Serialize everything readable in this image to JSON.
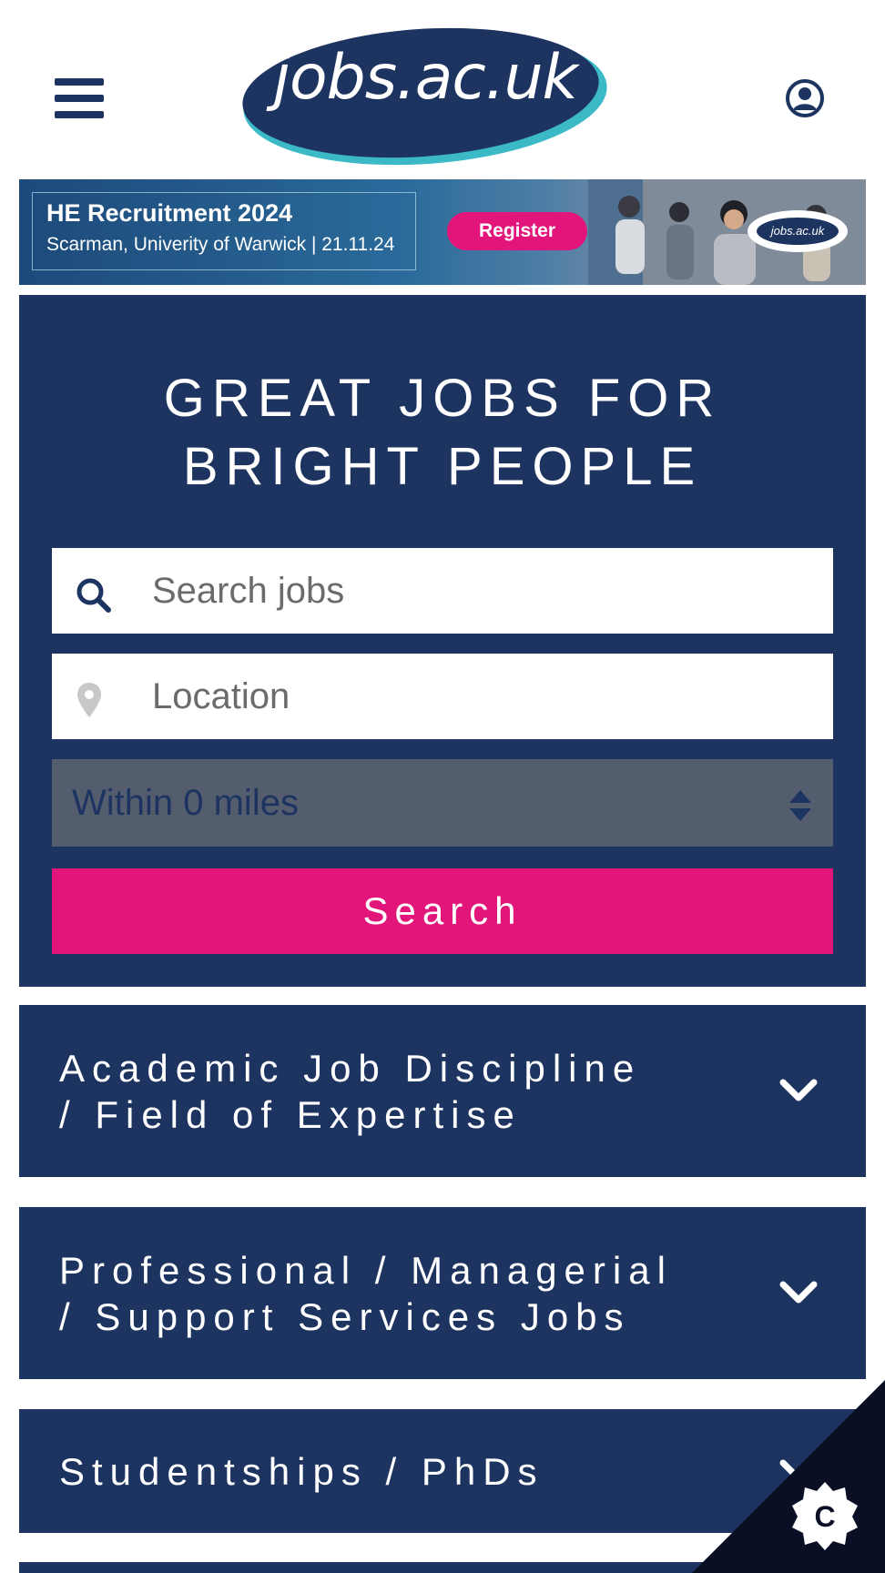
{
  "header": {
    "logo_text": "jobs.ac.uk",
    "menu_icon": "hamburger-menu-icon",
    "user_icon": "user-account-icon"
  },
  "banner": {
    "title": "HE Recruitment 2024",
    "subtitle": "Scarman, Univerity of Warwick | 21.11.24",
    "button_label": "Register",
    "logo_text": "jobs.ac.uk"
  },
  "hero": {
    "title_line1": "GREAT JOBS FOR",
    "title_line2": "BRIGHT PEOPLE",
    "search_placeholder": "Search jobs",
    "search_icon": "search-icon",
    "location_placeholder": "Location",
    "location_icon": "map-pin-icon",
    "distance_value": "Within 0 miles",
    "search_button": "Search"
  },
  "accordions": [
    {
      "line1": "Academic Job Discipline",
      "line2": "/ Field of Expertise"
    },
    {
      "line1": "Professional / Managerial",
      "line2": "/ Support Services Jobs"
    },
    {
      "line1": "Studentships / PhDs"
    }
  ],
  "colors": {
    "navy": "#1d3461",
    "pink": "#e2157a",
    "teal": "#3cb9c6",
    "select_bg": "#545d6d"
  }
}
